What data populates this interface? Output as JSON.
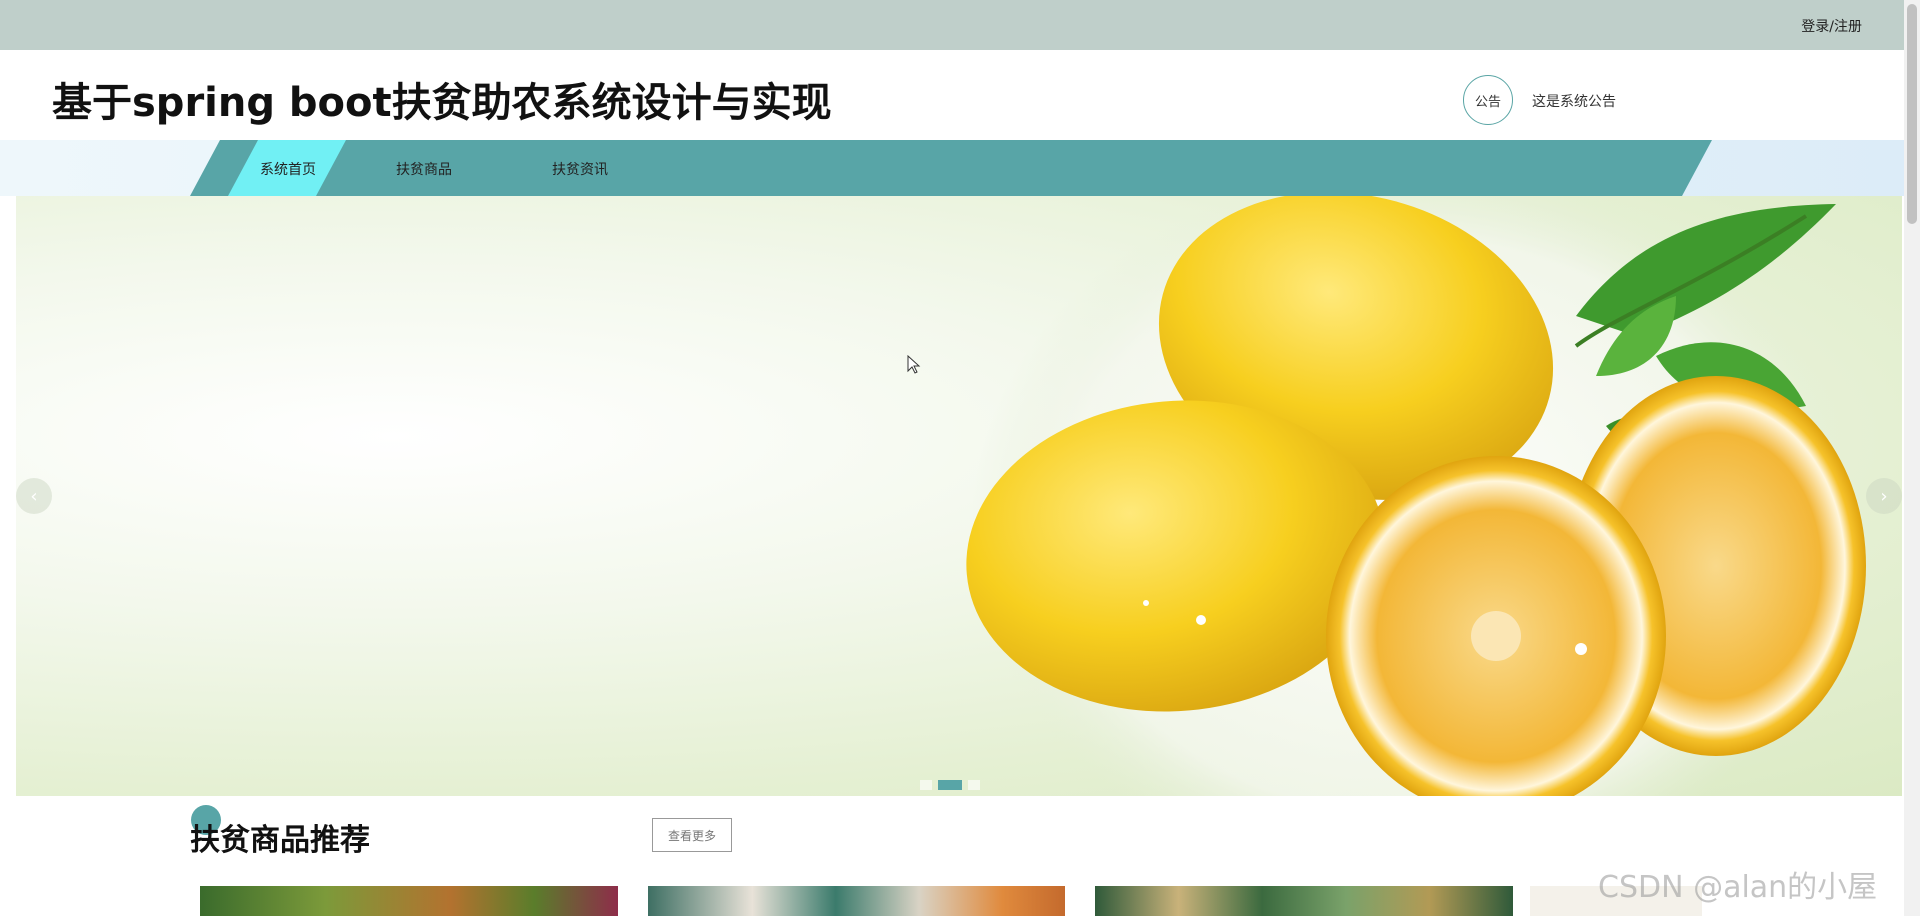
{
  "topbar": {
    "login_register": "登录/注册"
  },
  "header": {
    "site_title": "基于spring boot扶贫助农系统设计与实现",
    "notice_label": "公告",
    "notice_text": "这是系统公告"
  },
  "nav": {
    "items": [
      {
        "label": "系统首页",
        "active": true
      },
      {
        "label": "扶贫商品",
        "active": false
      },
      {
        "label": "扶贫资讯",
        "active": false
      }
    ]
  },
  "carousel": {
    "prev_icon": "chevron-left-icon",
    "next_icon": "chevron-right-icon",
    "slide_count": 3,
    "active_index": 1
  },
  "section": {
    "title": "扶贫商品推荐",
    "more_label": "查看更多"
  },
  "watermark": "CSDN @alan的小屋",
  "colors": {
    "topbar": "#bfcfca",
    "nav": "#58a5a7",
    "nav_active": "#71f0f4",
    "accent": "#58a5a7"
  }
}
